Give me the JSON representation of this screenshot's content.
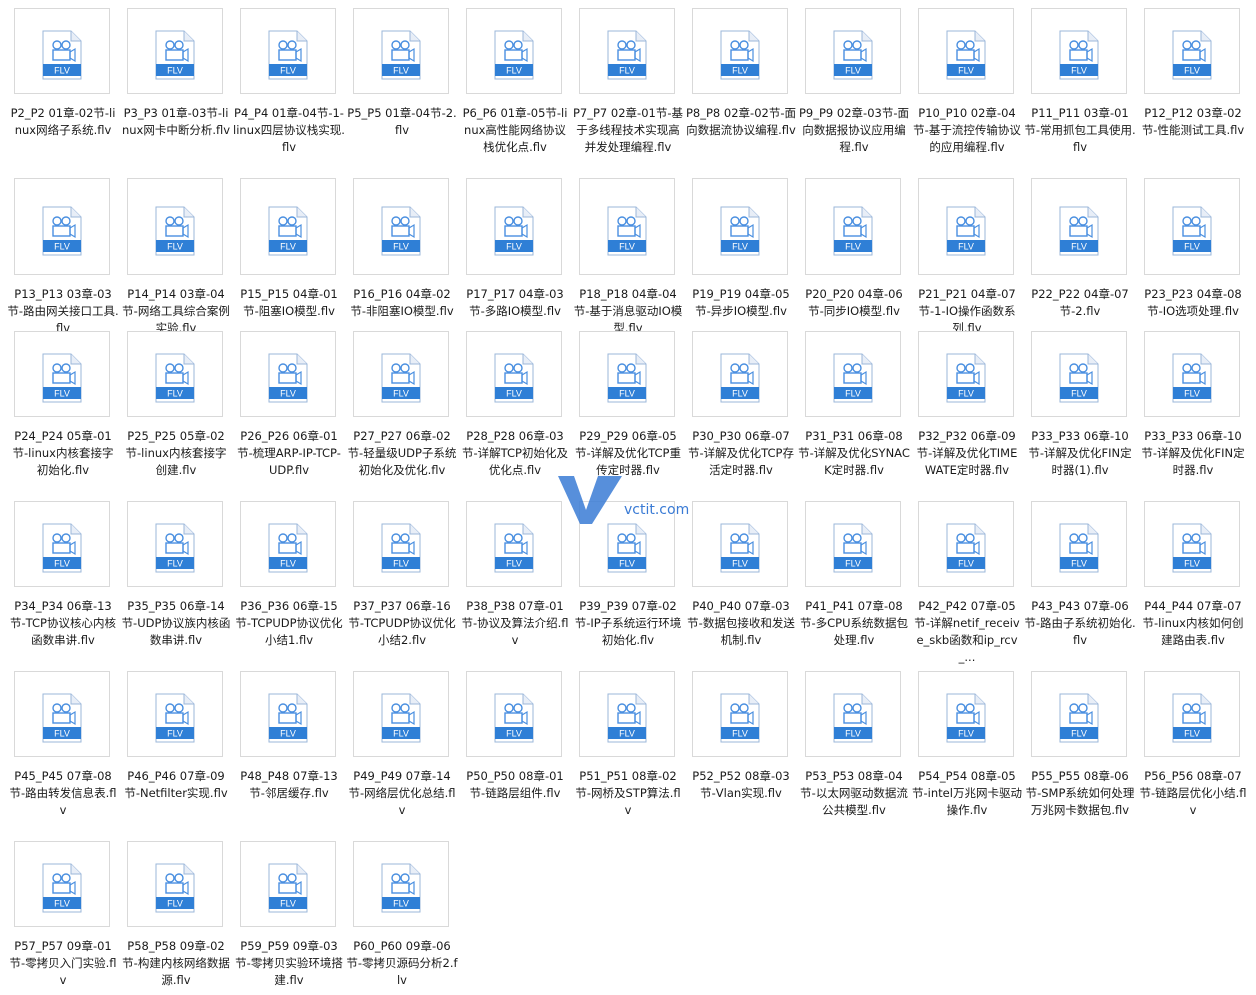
{
  "folder": {
    "icon_type": "flv-video-file-icon",
    "icon_label": "FLV",
    "accent_color": "#2f7fd6",
    "files": [
      "P2_P2 01章-02节-linux网络子系统.flv",
      "P3_P3 01章-03节-linux网卡中断分析.flv",
      "P4_P4 01章-04节-1-linux四层协议栈实现.flv",
      "P5_P5 01章-04节-2.flv",
      "P6_P6 01章-05节-linux高性能网络协议栈优化点.flv",
      "P7_P7 02章-01节-基于多线程技术实现高并发处理编程.flv",
      "P8_P8 02章-02节-面向数据流协议编程.flv",
      "P9_P9 02章-03节-面向数据报协议应用编程.flv",
      "P10_P10 02章-04节-基于流控传输协议的应用编程.flv",
      "P11_P11 03章-01节-常用抓包工具使用.flv",
      "P12_P12 03章-02节-性能测试工具.flv",
      "P13_P13 03章-03节-路由网关接口工具.flv",
      "P14_P14 03章-04节-网络工具综合案例实验.flv",
      "P15_P15 04章-01节-阻塞IO模型.flv",
      "P16_P16 04章-02节-非阻塞IO模型.flv",
      "P17_P17 04章-03节-多路IO模型.flv",
      "P18_P18 04章-04节-基于消息驱动IO模型.flv",
      "P19_P19 04章-05节-异步IO模型.flv",
      "P20_P20 04章-06节-同步IO模型.flv",
      "P21_P21 04章-07节-1-IO操作函数系列.flv",
      "P22_P22 04章-07节-2.flv",
      "P23_P23 04章-08节-IO选项处理.flv",
      "P24_P24 05章-01节-linux内核套接字初始化.flv",
      "P25_P25 05章-02节-linux内核套接字创建.flv",
      "P26_P26 06章-01节-梳理ARP-IP-TCP-UDP.flv",
      "P27_P27 06章-02节-轻量级UDP子系统初始化及优化.flv",
      "P28_P28 06章-03节-详解TCP初始化及优化点.flv",
      "P29_P29 06章-05节-详解及优化TCP重传定时器.flv",
      "P30_P30 06章-07节-详解及优化TCP存活定时器.flv",
      "P31_P31 06章-08节-详解及优化SYNACK定时器.flv",
      "P32_P32 06章-09节-详解及优化TIMEWATE定时器.flv",
      "P33_P33 06章-10节-详解及优化FIN定时器(1).flv",
      "P33_P33 06章-10节-详解及优化FIN定时器.flv",
      "P34_P34 06章-13节-TCP协议核心内核函数串讲.flv",
      "P35_P35 06章-14节-UDP协议族内核函数串讲.flv",
      "P36_P36 06章-15节-TCPUDP协议优化小结1.flv",
      "P37_P37 06章-16节-TCPUDP协议优化小结2.flv",
      "P38_P38 07章-01节-协议及算法介绍.flv",
      "P39_P39 07章-02节-IP子系统运行环境初始化.flv",
      "P40_P40 07章-03节-数据包接收和发送机制.flv",
      "P41_P41 07章-08节-多CPU系统数据包处理.flv",
      "P42_P42 07章-05节-详解netif_receive_skb函数和ip_rcv_...",
      "P43_P43 07章-06节-路由子系统初始化.flv",
      "P44_P44 07章-07节-linux内核如何创建路由表.flv",
      "P45_P45 07章-08节-路由转发信息表.flv",
      "P46_P46 07章-09节-Netfilter实现.flv",
      "P48_P48 07章-13节-邻居缓存.flv",
      "P49_P49 07章-14节-网络层优化总结.flv",
      "P50_P50 08章-01节-链路层组件.flv",
      "P51_P51 08章-02节-网桥及STP算法.flv",
      "P52_P52 08章-03节-Vlan实现.flv",
      "P53_P53 08章-04节-以太网驱动数据流公共模型.flv",
      "P54_P54 08章-05节-intel万兆网卡驱动操作.flv",
      "P55_P55 08章-06节-SMP系统如何处理万兆网卡数据包.flv",
      "P56_P56 08章-07节-链路层优化小结.flv",
      "P57_P57 09章-01节-零拷贝入门实验.flv",
      "P58_P58 09章-02节-构建内核网络数据源.flv",
      "P59_P59 09章-03节-零拷贝实验环境搭建.flv",
      "P60_P60 09章-06节-零拷贝源码分析2.flv"
    ]
  },
  "watermark": {
    "text": "vctit.com",
    "color": "#3a7bd5"
  }
}
